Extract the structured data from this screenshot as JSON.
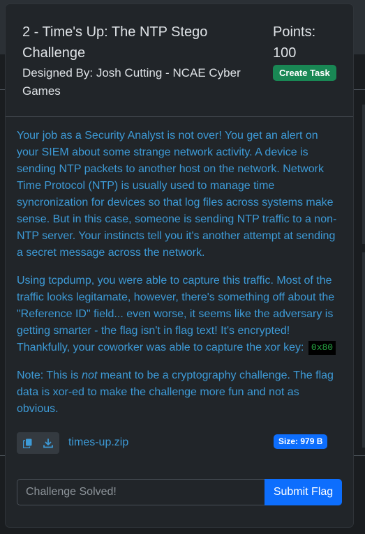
{
  "challenge": {
    "title": "2 - Time's Up: The NTP Stego Challenge",
    "designer": "Designed By: Josh Cutting - NCAE Cyber Games",
    "points_label": "Points:",
    "points_value": "100",
    "create_task_label": "Create Task"
  },
  "description": {
    "paragraph1": "Your job as a Security Analyst is not over! You get an alert on your SIEM about some strange network activity. A device is sending NTP packets to another host on the network. Network Time Protocol (NTP) is usually used to manage time syncronization for devices so that log files across systems make sense. But in this case, someone is sending NTP traffic to a non-NTP server. Your instincts tell you it's another attempt at sending a secret message across the network.",
    "paragraph2": "Using tcpdump, you were able to capture this traffic. Most of the traffic looks legitamate, however, there's something off about the \"Reference ID\" field... even worse, it seems like the adversary is getting smarter - the flag isn't in flag text! It's encrypted! Thankfully, your coworker was able to capture the xor key:",
    "xor_key": "0x80",
    "note_prefix": "Note: This is ",
    "note_emphasis": "not",
    "note_suffix": " meant to be a cryptography challenge. The flag data is xor-ed to make the challenge more fun and not as obvious."
  },
  "attachment": {
    "file_name": "times-up.zip",
    "size": "Size: 979 B",
    "copy_icon": "copy-icon",
    "download_icon": "download-icon"
  },
  "flag_form": {
    "placeholder": "Challenge Solved!",
    "submit_label": "Submit Flag"
  },
  "colors": {
    "accent_text": "#3d9ad6",
    "create_task": "#198754",
    "primary": "#0d6efd",
    "modal_bg": "#212529"
  }
}
